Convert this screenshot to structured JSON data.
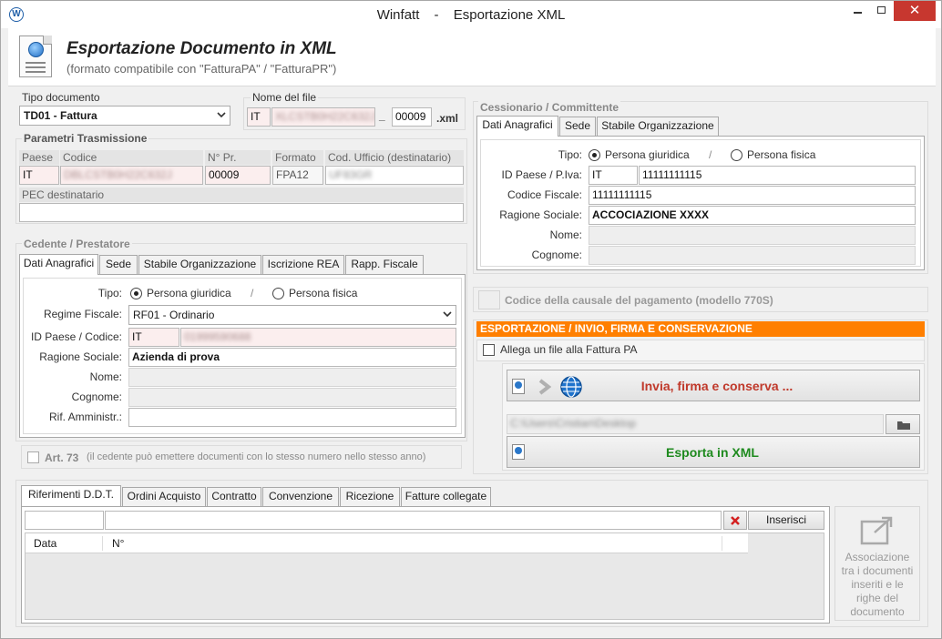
{
  "window": {
    "app_name": "Winfatt",
    "separator": "-",
    "window_title": "Esportazione XML",
    "close_glyph": "✕"
  },
  "header": {
    "title": "Esportazione Documento in XML",
    "subtitle": "(formato compatibile con \"FatturaPA\" / \"FatturaPR\")"
  },
  "tipo_documento": {
    "label": "Tipo documento",
    "selected": "TD01 - Fattura"
  },
  "nome_file": {
    "label": "Nome del file",
    "country": "IT",
    "code": "XLCSTB0H22C632J",
    "underscore": "_",
    "progressive": "00009",
    "extension": ".xml"
  },
  "parametri": {
    "title": "Parametri Trasmissione",
    "headers": [
      "Paese",
      "Codice",
      "N° Pr.",
      "Formato",
      "Cod. Ufficio (destinatario)"
    ],
    "paese": "IT",
    "codice": "DBLCSTB0H22C632J",
    "numero": "00009",
    "formato": "FPA12",
    "ufficio": "UF83GR",
    "pec_label": "PEC destinatario",
    "pec_value": ""
  },
  "cedente": {
    "title": "Cedente / Prestatore",
    "tabs": [
      "Dati Anagrafici",
      "Sede",
      "Stabile Organizzazione",
      "Iscrizione REA",
      "Rapp. Fiscale"
    ],
    "tipo_label": "Tipo:",
    "option_giuridica": "Persona giuridica",
    "slash": "/",
    "option_fisica": "Persona fisica",
    "regime_label": "Regime Fiscale:",
    "regime_value": "RF01 - Ordinario",
    "id_label": "ID Paese / Codice:",
    "id_paese": "IT",
    "id_codice": "01999590688",
    "ragione_label": "Ragione Sociale:",
    "ragione_value": "Azienda di prova",
    "nome_label": "Nome:",
    "cognome_label": "Cognome:",
    "rif_label": "Rif. Amministr.:"
  },
  "art73": {
    "label": "Art. 73",
    "note": "(il cedente può emettere documenti con lo stesso numero nello stesso anno)"
  },
  "cessionario": {
    "title": "Cessionario / Committente",
    "tabs": [
      "Dati Anagrafici",
      "Sede",
      "Stabile Organizzazione"
    ],
    "tipo_label": "Tipo:",
    "option_giuridica": "Persona giuridica",
    "slash": "/",
    "option_fisica": "Persona fisica",
    "id_label": "ID Paese / P.Iva:",
    "id_paese": "IT",
    "id_piva": "11111111115",
    "cf_label": "Codice Fiscale:",
    "cf_value": "11111111115",
    "ragione_label": "Ragione Sociale:",
    "ragione_value": "ACCOCIAZIONE XXXX",
    "nome_label": "Nome:",
    "cognome_label": "Cognome:"
  },
  "causale": {
    "label": "Codice della causale del pagamento (modello 770S)"
  },
  "esportazione": {
    "title": "ESPORTAZIONE / INVIO, FIRMA E CONSERVAZIONE",
    "allega_label": "Allega un file alla Fattura PA",
    "invia_label": "Invia, firma e conserva ...",
    "path": "C:\\Users\\Cristian\\Desktop",
    "esporta_label": "Esporta in XML"
  },
  "bottom": {
    "tabs": [
      "Riferimenti D.D.T.",
      "Ordini Acquisto",
      "Contratto",
      "Convenzione",
      "Ricezione",
      "Fatture collegate"
    ],
    "inserisci_label": "Inserisci",
    "columns": [
      "Data",
      "N°"
    ],
    "assoc_label": "Associazione tra i documenti inseriti e le righe del documento"
  },
  "colors": {
    "orange": "#ff7f00",
    "invia_text": "#c0392b",
    "esporta_text": "#1e8a1e",
    "close_red": "#c7372f"
  }
}
